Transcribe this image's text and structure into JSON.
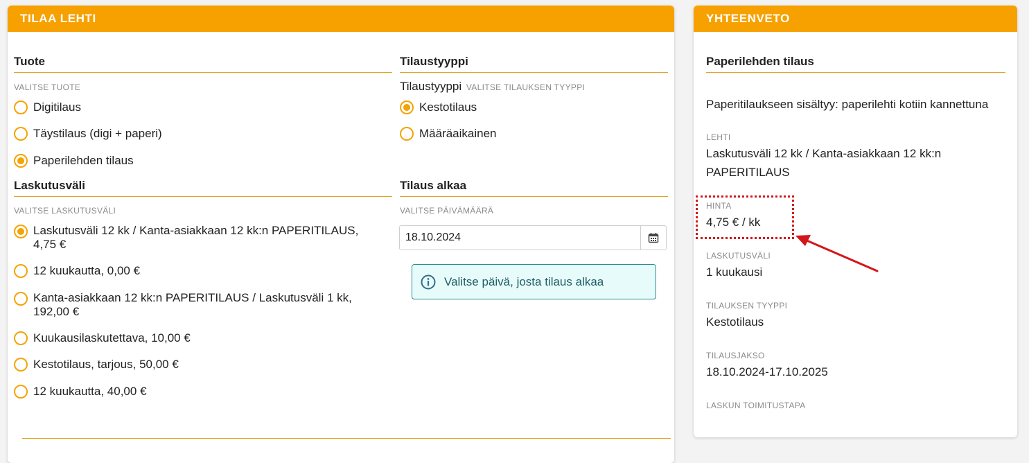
{
  "order": {
    "header": "TILAA LEHTI",
    "product": {
      "title": "Tuote",
      "hint": "VALITSE TUOTE",
      "options": [
        {
          "label": "Digitilaus",
          "checked": false
        },
        {
          "label": "Täystilaus (digi + paperi)",
          "checked": false
        },
        {
          "label": "Paperilehden tilaus",
          "checked": true
        }
      ]
    },
    "order_type": {
      "title": "Tilaustyyppi",
      "inline_label": "Tilaustyyppi",
      "hint": "VALITSE TILAUKSEN TYYPPI",
      "options": [
        {
          "label": "Kestotilaus",
          "checked": true
        },
        {
          "label": "Määräaikainen",
          "checked": false
        }
      ]
    },
    "billing": {
      "title": "Laskutusväli",
      "hint": "VALITSE LASKUTUSVÄLI",
      "options": [
        {
          "label": "Laskutusväli 12 kk / Kanta-asiakkaan 12 kk:n PAPERITILAUS, 4,75 €",
          "checked": true
        },
        {
          "label": "12 kuukautta, 0,00 €",
          "checked": false
        },
        {
          "label": "Kanta-asiakkaan 12 kk:n PAPERITILAUS / Laskutusväli 1 kk, 192,00 €",
          "checked": false
        },
        {
          "label": "Kuukausilaskutettava, 10,00 €",
          "checked": false
        },
        {
          "label": "Kestotilaus, tarjous, 50,00 €",
          "checked": false
        },
        {
          "label": "12 kuukautta, 40,00 €",
          "checked": false
        }
      ]
    },
    "start": {
      "title": "Tilaus alkaa",
      "hint": "VALITSE PÄIVÄMÄÄRÄ",
      "date_value": "18.10.2024",
      "calendar_icon": "calendar-icon",
      "info_icon": "info-icon",
      "info_text": "Valitse päivä, josta tilaus alkaa"
    }
  },
  "summary": {
    "header": "YHTEENVETO",
    "title": "Paperilehden tilaus",
    "description": "Paperitilaukseen sisältyy: paperilehti kotiin kannettuna",
    "fields": [
      {
        "label": "LEHTI",
        "value": "Laskutusväli 12 kk / Kanta-asiakkaan 12 kk:n PAPERITILAUS"
      },
      {
        "label": "HINTA",
        "value": "4,75 € / kk"
      },
      {
        "label": "LASKUTUSVÄLI",
        "value": "1 kuukausi"
      },
      {
        "label": "TILAUKSEN TYYPPI",
        "value": "Kestotilaus"
      },
      {
        "label": "TILAUSJAKSO",
        "value": "18.10.2024-17.10.2025"
      },
      {
        "label": "LASKUN TOIMITUSTAPA",
        "value": ""
      }
    ]
  },
  "colors": {
    "accent": "#f7a100",
    "annotation": "#d3161a",
    "info_border": "#2a8a8a"
  }
}
